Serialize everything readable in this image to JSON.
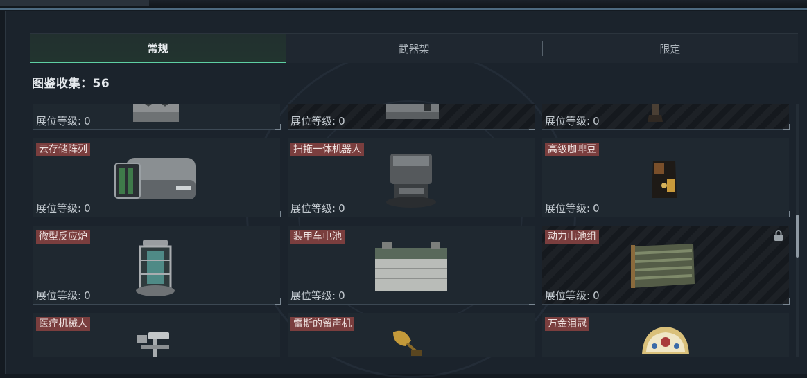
{
  "tabs": [
    {
      "label": "常规",
      "active": true
    },
    {
      "label": "武器架",
      "active": false
    },
    {
      "label": "限定",
      "active": false
    }
  ],
  "collection": {
    "label": "图鉴收集：56"
  },
  "level_label": "展位等级:",
  "rows": [
    [
      {
        "name": "",
        "level": "0",
        "icon": "crate-icon",
        "dark": false,
        "locked": false
      },
      {
        "name": "",
        "level": "0",
        "icon": "device-icon",
        "dark": true,
        "locked": false
      },
      {
        "name": "",
        "level": "0",
        "icon": "boot-icon",
        "dark": true,
        "locked": false
      }
    ],
    [
      {
        "name": "云存储阵列",
        "level": "0",
        "icon": "server-array-icon",
        "dark": false,
        "locked": false
      },
      {
        "name": "扫拖一体机器人",
        "level": "0",
        "icon": "robot-vacuum-icon",
        "dark": false,
        "locked": false
      },
      {
        "name": "高级咖啡豆",
        "level": "0",
        "icon": "coffee-bag-icon",
        "dark": false,
        "locked": false
      }
    ],
    [
      {
        "name": "微型反应炉",
        "level": "0",
        "icon": "reactor-icon",
        "dark": false,
        "locked": false
      },
      {
        "name": "装甲车电池",
        "level": "0",
        "icon": "vehicle-battery-icon",
        "dark": false,
        "locked": false
      },
      {
        "name": "动力电池组",
        "level": "0",
        "icon": "battery-pack-icon",
        "dark": true,
        "locked": true
      }
    ],
    [
      {
        "name": "医疗机械人",
        "level": "",
        "icon": "medical-robot-icon",
        "dark": false,
        "locked": false
      },
      {
        "name": "雷斯的留声机",
        "level": "",
        "icon": "gramophone-icon",
        "dark": false,
        "locked": false
      },
      {
        "name": "万金泪冠",
        "level": "",
        "icon": "jeweled-crown-icon",
        "dark": false,
        "locked": false
      }
    ]
  ],
  "colors": {
    "accent": "#5ecfa3",
    "name_tag": "#7a3e3e",
    "panel": "#1b232c"
  }
}
